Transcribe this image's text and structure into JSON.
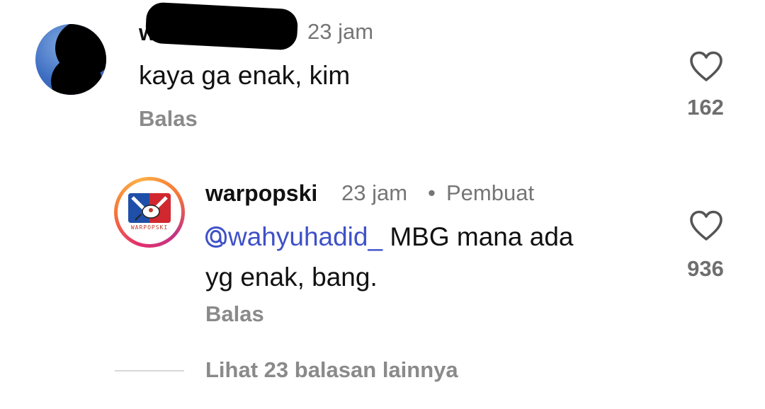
{
  "comment": {
    "username_visible": "w",
    "time": "23 jam",
    "text": "kaya ga enak, kim",
    "reply_label": "Balas",
    "like_count": "162",
    "like_icon": "heart-outline-icon"
  },
  "reply": {
    "username": "warpopski",
    "time": "23 jam",
    "separator": "•",
    "badge": "Pembuat",
    "avatar_logo_text": "WARPOPSKI",
    "mention_icon": "threads-at-icon",
    "mention": "wahyuhadid_",
    "text_line1": " MBG mana ada",
    "text_line2": "yg enak, bang.",
    "reply_label": "Balas",
    "like_count": "936",
    "like_icon": "heart-outline-icon"
  },
  "view_more": {
    "label": "Lihat 23 balasan lainnya"
  },
  "colors": {
    "mention": "#3f51c7",
    "secondary_text": "#757575",
    "reply_label": "#8a8a8a"
  }
}
